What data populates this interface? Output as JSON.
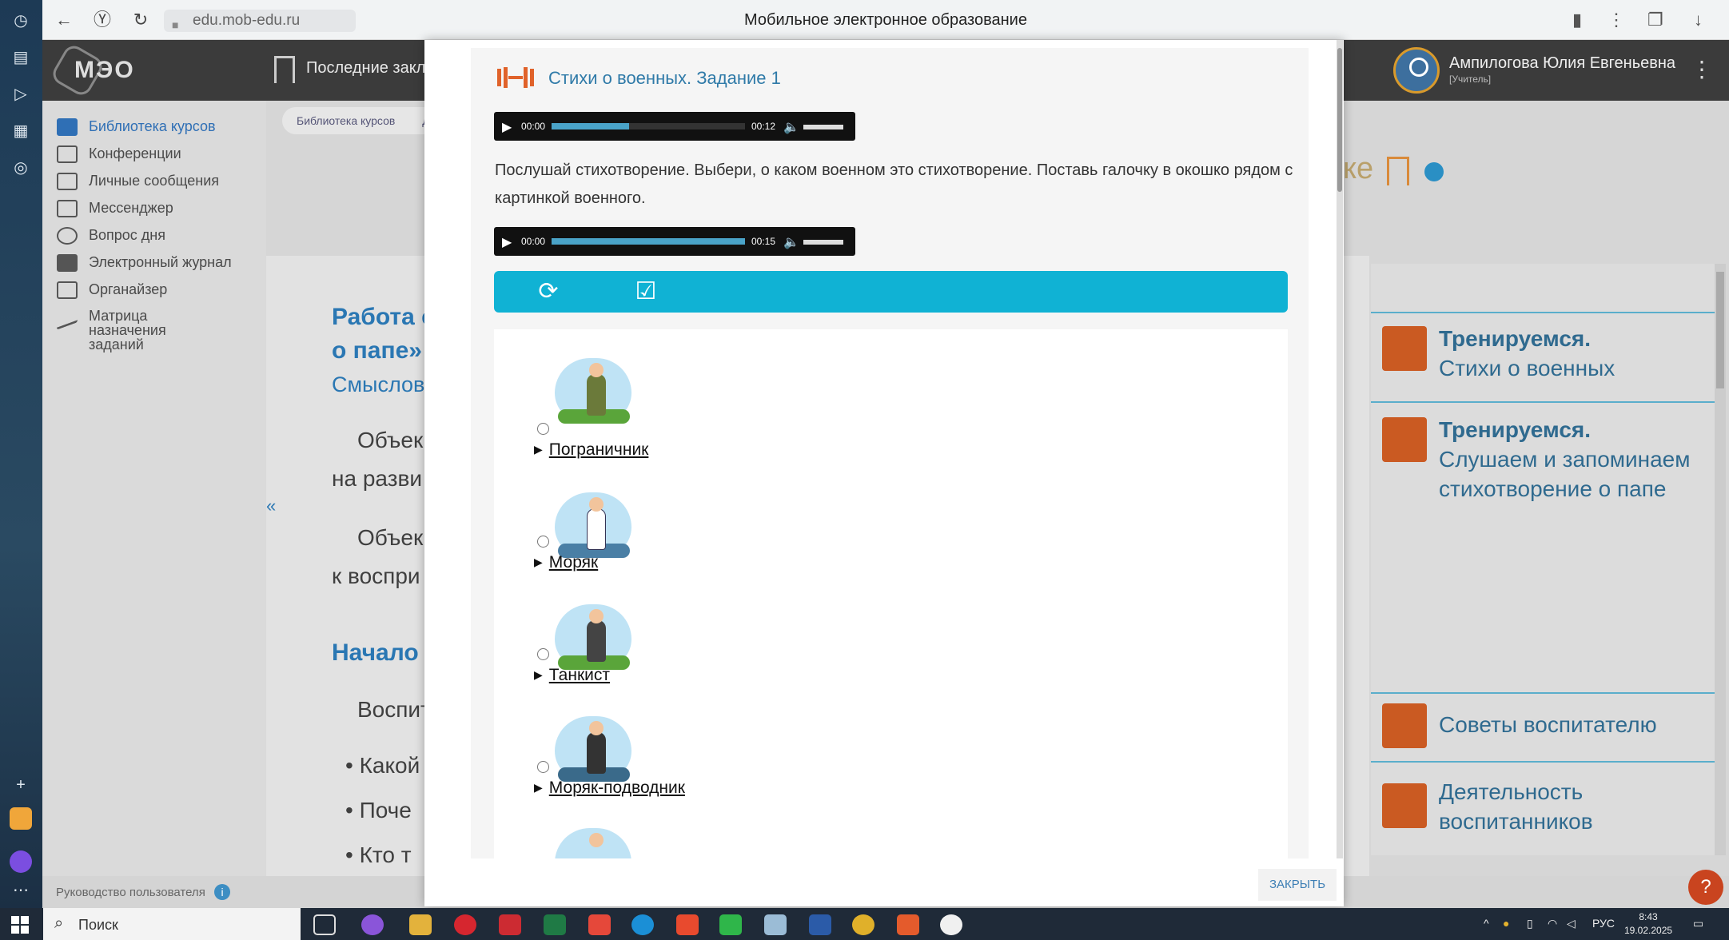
{
  "browser": {
    "url": "edu.mob-edu.ru",
    "title": "Мобильное электронное образование"
  },
  "header": {
    "logo_text": "МЭО",
    "recent_label": "Последние закла",
    "user_name": "Ампилогова Юлия Евгеньевна",
    "user_role": "[Учитель]"
  },
  "sidebar": {
    "items": [
      {
        "label": "Библиотека курсов"
      },
      {
        "label": "Конференции"
      },
      {
        "label": "Личные сообщения"
      },
      {
        "label": "Мессенджер"
      },
      {
        "label": "Вопрос дня"
      },
      {
        "label": "Электронный журнал"
      },
      {
        "label": "Органайзер"
      },
      {
        "label": "Матрица назначения заданий"
      }
    ],
    "collapse": "«"
  },
  "background": {
    "breadcrumb": "Библиотека курсов",
    "breadcrumb_next": "Д",
    "partial_title": "ке",
    "heading1_line1": "Работа с",
    "heading1_line2": "о папе»",
    "heading1_sub": "Смыслов",
    "para1_line1": "Объек",
    "para1_line2": "на разви",
    "para2_line1": "Объек",
    "para2_line2": "к воспри",
    "heading2": "Начало",
    "para3": "Воспит",
    "bullets": [
      "Какой",
      "Поче",
      "Кто т"
    ],
    "footer_link": "Руководство пользователя",
    "footer_info": "i",
    "help": "?"
  },
  "right_panel": {
    "cards": [
      {
        "title": "Тренируемся.",
        "sub": "Стихи о военных"
      },
      {
        "title": "Тренируемся.",
        "sub": "Слушаем и запоминаем стихотворение о папе"
      },
      {
        "title": "",
        "sub": "Советы воспитателю"
      },
      {
        "title": "",
        "sub": "Деятельность воспитанников"
      }
    ]
  },
  "modal": {
    "task_title": "Стихи о военных. Задание 1",
    "audio1": {
      "current": "00:00",
      "duration": "00:12",
      "progress": 0.4
    },
    "audio2": {
      "current": "00:00",
      "duration": "00:15",
      "progress": 1.0
    },
    "instruction": "Послушай стихотворение. Выбери, о каком военном это стихотворение. Поставь галочку в окошко рядом с картинкой военного.",
    "options": [
      {
        "label": "Пограничник"
      },
      {
        "label": "Моряк"
      },
      {
        "label": "Танкист"
      },
      {
        "label": "Моряк-подводник"
      }
    ],
    "close_label": "ЗАКРЫТЬ"
  },
  "taskbar": {
    "search_placeholder": "Поиск",
    "language": "РУС",
    "time": "8:43",
    "date": "19.02.2025"
  },
  "colors": {
    "accent_blue": "#10b2d4",
    "orange": "#e0622a",
    "link_blue": "#2f7aa8"
  }
}
